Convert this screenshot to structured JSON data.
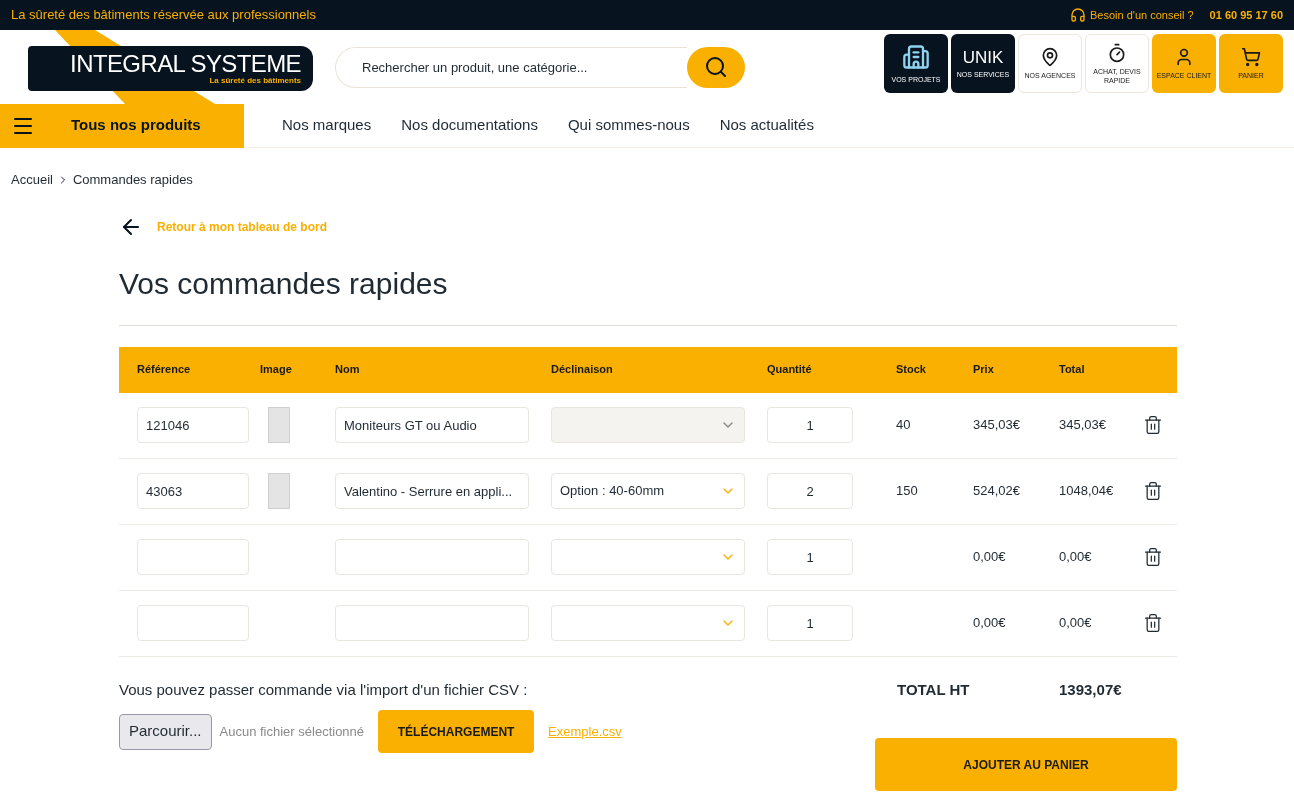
{
  "top_bar": {
    "tagline": "La sûreté des bâtiments réservée aux professionnels",
    "help": "Besoin d'un conseil ?",
    "phone": "01 60 95 17 60"
  },
  "logo": {
    "name": "INTEGRAL SYSTEME",
    "subtitle": "La sûreté des bâtiments"
  },
  "search": {
    "placeholder": "Rechercher un produit, une catégorie..."
  },
  "shortcuts": [
    {
      "kind": "buildings",
      "label": "VOS PROJETS"
    },
    {
      "kind": "brand",
      "label": "NOS SERVICES",
      "brand": "UNIK"
    },
    {
      "kind": "pin",
      "label": "NOS AGENCES"
    },
    {
      "kind": "timer",
      "label": "ACHAT, DEVIS RAPIDE"
    },
    {
      "kind": "user",
      "label": "ESPACE CLIENT"
    },
    {
      "kind": "cart",
      "label": "PANIER"
    }
  ],
  "nav": {
    "all_products": "Tous nos produits",
    "items": [
      "Nos marques",
      "Nos documentations",
      "Qui sommes-nous",
      "Nos actualités"
    ]
  },
  "breadcrumb": [
    "Accueil",
    "Commandes rapides"
  ],
  "back_link": "Retour à mon tableau de bord",
  "title": "Vos commandes rapides",
  "table": {
    "columns": [
      "Référence",
      "Image",
      "Nom",
      "Déclinaison",
      "Quantité",
      "Stock",
      "Prix",
      "Total"
    ],
    "rows": [
      {
        "reference": "121046",
        "photo": true,
        "name": "Moniteurs GT ou Audio",
        "variant": "",
        "variant_disabled": true,
        "quantity": "1",
        "stock": "40",
        "price": "345,03€",
        "total": "345,03€"
      },
      {
        "reference": "43063",
        "photo": true,
        "name": "Valentino - Serrure en appli...",
        "variant": "Option : 40-60mm",
        "variant_disabled": false,
        "quantity": "2",
        "stock": "150",
        "price": "524,02€",
        "total": "1048,04€"
      },
      {
        "reference": "",
        "photo": false,
        "name": "",
        "variant": "",
        "variant_disabled": false,
        "quantity": "1",
        "stock": "",
        "price": "0,00€",
        "total": "0,00€"
      },
      {
        "reference": "",
        "photo": false,
        "name": "",
        "variant": "",
        "variant_disabled": false,
        "quantity": "1",
        "stock": "",
        "price": "0,00€",
        "total": "0,00€"
      }
    ]
  },
  "csv": {
    "text": "Vous pouvez passer commande via l'import d'un fichier CSV :",
    "browse": "Parcourir...",
    "no_file": "Aucun fichier sélectionné",
    "upload": "TÉLÉCHARGEMENT",
    "example": "Exemple.csv"
  },
  "summary": {
    "label": "TOTAL HT",
    "value": "1393,07€",
    "add_to_cart": "AJOUTER AU PANIER"
  }
}
